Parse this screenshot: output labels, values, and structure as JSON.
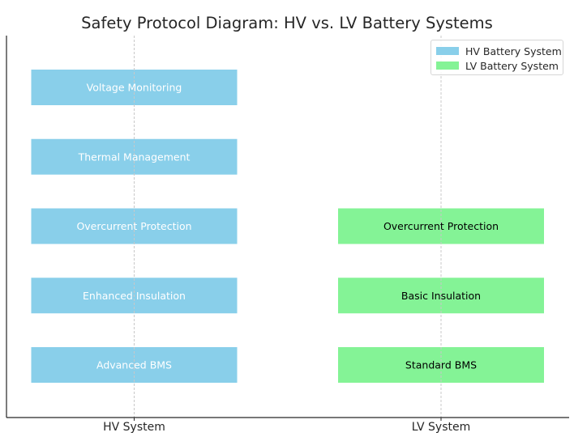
{
  "chart_data": {
    "type": "bar",
    "title": "Safety Protocol Diagram: HV vs. LV Battery Systems",
    "xlabel": "",
    "ylabel": "",
    "x_categories": [
      "HV System",
      "LV System"
    ],
    "rows": 5,
    "grid": "vertical dashed at category ticks",
    "legend_position": "top-right",
    "series": [
      {
        "name": "HV Battery System",
        "color": "#89CFEA",
        "text_color": "#ffffff",
        "category": "HV System",
        "items": [
          {
            "row": 5,
            "label": "Voltage Monitoring"
          },
          {
            "row": 4,
            "label": "Thermal Management"
          },
          {
            "row": 3,
            "label": "Overcurrent Protection"
          },
          {
            "row": 2,
            "label": "Enhanced Insulation"
          },
          {
            "row": 1,
            "label": "Advanced BMS"
          }
        ]
      },
      {
        "name": "LV Battery System",
        "color": "#84F396",
        "text_color": "#000000",
        "category": "LV System",
        "items": [
          {
            "row": 3,
            "label": "Overcurrent Protection"
          },
          {
            "row": 2,
            "label": "Basic Insulation"
          },
          {
            "row": 1,
            "label": "Standard BMS"
          }
        ]
      }
    ]
  }
}
